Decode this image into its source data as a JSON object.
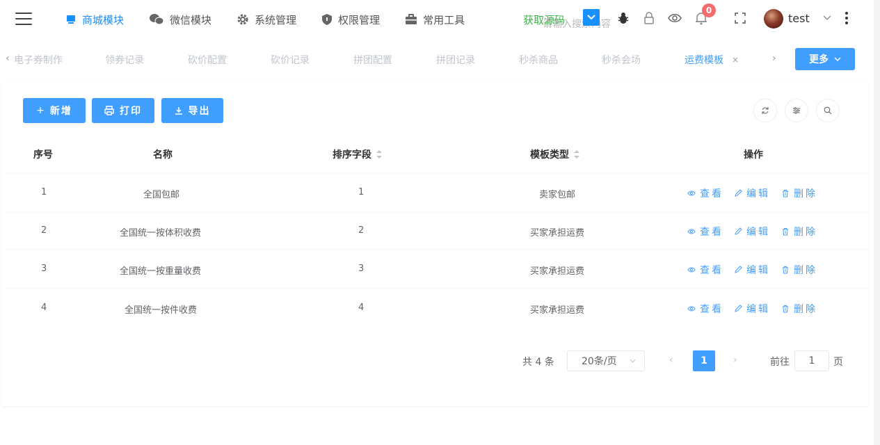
{
  "topbar": {
    "menu": [
      {
        "label": "商城模块",
        "icon": "monitor-icon",
        "active": true
      },
      {
        "label": "微信模块",
        "icon": "wechat-icon",
        "active": false
      },
      {
        "label": "系统管理",
        "icon": "gear-icon",
        "active": false
      },
      {
        "label": "权限管理",
        "icon": "shield-icon",
        "active": false
      },
      {
        "label": "常用工具",
        "icon": "briefcase-icon",
        "active": false
      }
    ],
    "source_link": "获取源码",
    "search_placeholder": "请输入搜索内容",
    "notification_count": "0",
    "username": "test"
  },
  "tabs": {
    "items": [
      "电子券制作",
      "领券记录",
      "砍价配置",
      "砍价记录",
      "拼团配置",
      "拼团记录",
      "秒杀商品",
      "秒杀会场",
      "运费模板"
    ],
    "active": "运费模板",
    "more_label": "更多"
  },
  "toolbar": {
    "add_label": "新增",
    "print_label": "打印",
    "export_label": "导出"
  },
  "table": {
    "headers": {
      "index": "序号",
      "name": "名称",
      "sort": "排序字段",
      "type": "模板类型",
      "ops": "操作"
    },
    "rows": [
      {
        "index": "1",
        "name": "全国包邮",
        "sort": "1",
        "type": "卖家包邮"
      },
      {
        "index": "2",
        "name": "全国统一按体积收费",
        "sort": "2",
        "type": "买家承担运费"
      },
      {
        "index": "3",
        "name": "全国统一按重量收费",
        "sort": "3",
        "type": "买家承担运费"
      },
      {
        "index": "4",
        "name": "全国统一按件收费",
        "sort": "4",
        "type": "买家承担运费"
      }
    ],
    "actions": {
      "view": "查看",
      "edit": "编辑",
      "delete": "删除"
    }
  },
  "pagination": {
    "total": "共 4 条",
    "page_size": "20条/页",
    "current_page": "1",
    "goto_prefix": "前往",
    "goto_value": "1",
    "goto_suffix": "页"
  },
  "colors": {
    "primary": "#409eff",
    "source_link": "#3bb54a",
    "badge": "#f56c6c"
  }
}
